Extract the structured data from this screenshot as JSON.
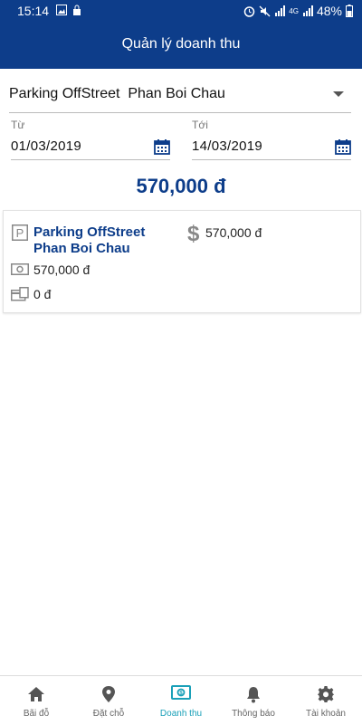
{
  "status_bar": {
    "time": "15:14",
    "network": "4G",
    "battery": "48%"
  },
  "header": {
    "title": "Quản lý doanh thu"
  },
  "selector": {
    "value": "Parking OffStreet  Phan Boi Chau"
  },
  "date_range": {
    "from_label": "Từ",
    "from_value": "01/03/2019",
    "to_label": "Tới",
    "to_value": "14/03/2019"
  },
  "total": "570,000 đ",
  "card": {
    "lot_name": "Parking OffStreet Phan Boi Chau",
    "total_amount": "570,000 đ",
    "cash_amount": "570,000 đ",
    "card_amount": "0 đ"
  },
  "nav": {
    "items": [
      {
        "label": "Bãi đỗ",
        "icon": "home-icon"
      },
      {
        "label": "Đặt chỗ",
        "icon": "location-pin-icon"
      },
      {
        "label": "Doanh thu",
        "icon": "money-icon",
        "active": true
      },
      {
        "label": "Thông báo",
        "icon": "bell-icon"
      },
      {
        "label": "Tài khoản",
        "icon": "gear-icon"
      }
    ]
  },
  "colors": {
    "primary": "#0d3d8a",
    "active_tab": "#1aa0b8"
  }
}
